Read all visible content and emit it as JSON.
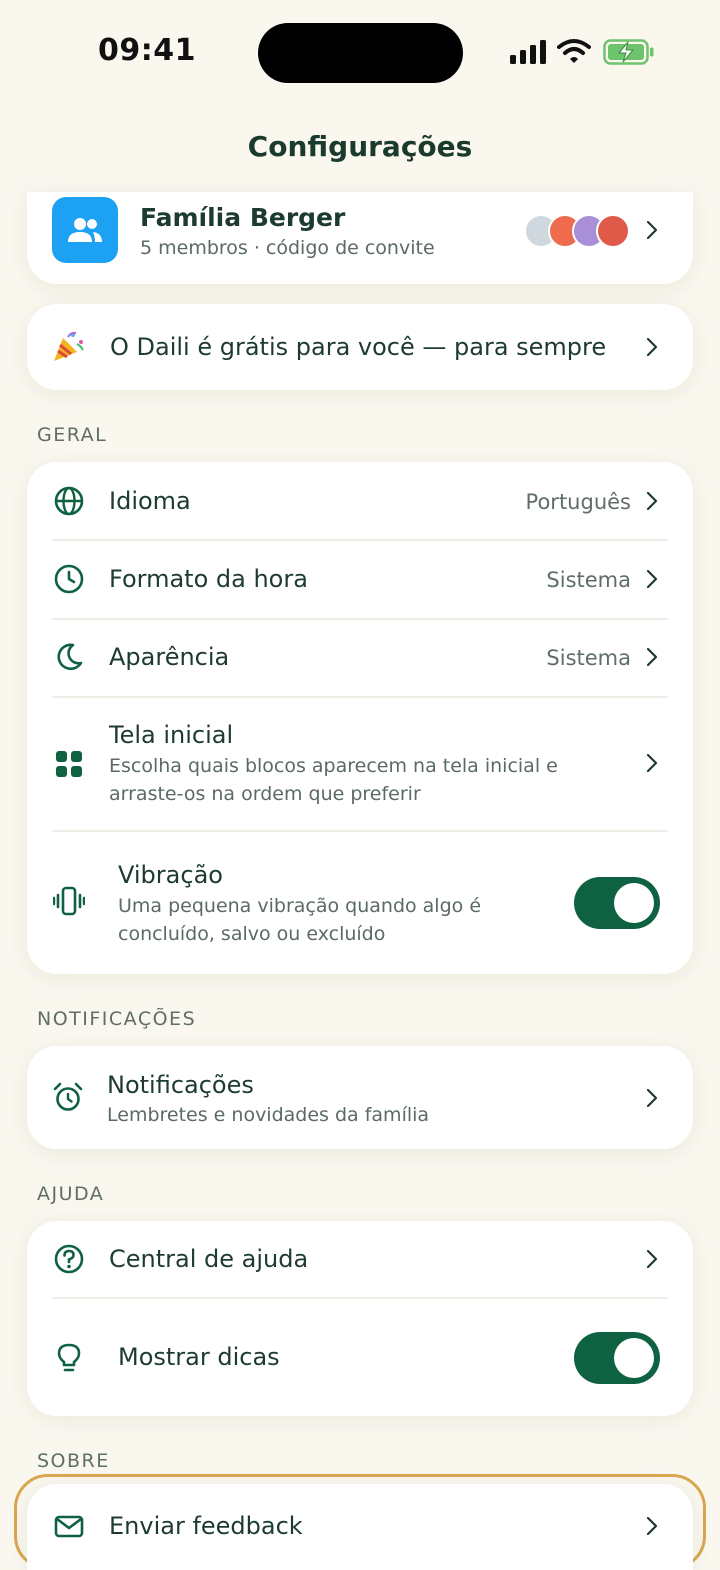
{
  "status_bar": {
    "time": "09:41"
  },
  "header": {
    "title": "Configurações"
  },
  "family": {
    "name": "Família Berger",
    "subtitle": "5 membros · código de convite"
  },
  "promo": {
    "text": "O Daili é grátis para você — para sempre"
  },
  "sections": {
    "general": "GERAL",
    "notifications": "NOTIFICAÇÕES",
    "help": "AJUDA",
    "about": "SOBRE"
  },
  "general": {
    "language": {
      "label": "Idioma",
      "value": "Português"
    },
    "time_format": {
      "label": "Formato da hora",
      "value": "Sistema"
    },
    "appearance": {
      "label": "Aparência",
      "value": "Sistema"
    },
    "home_screen": {
      "label": "Tela inicial",
      "description": "Escolha quais blocos aparecem na tela inicial e arraste-os na ordem que preferir"
    },
    "vibration": {
      "label": "Vibração",
      "description": "Uma pequena vibração quando algo é concluído, salvo ou excluído",
      "enabled": true
    }
  },
  "notifications": {
    "label": "Notificações",
    "description": "Lembretes e novidades da família"
  },
  "help": {
    "help_center": {
      "label": "Central de ajuda"
    },
    "show_tips": {
      "label": "Mostrar dicas",
      "enabled": true
    }
  },
  "about": {
    "feedback": {
      "label": "Enviar feedback"
    }
  },
  "colors": {
    "accent": "#0f6241",
    "background": "#f9f7ee",
    "family_icon": "#1da1f2",
    "highlight": "#d9a752"
  }
}
